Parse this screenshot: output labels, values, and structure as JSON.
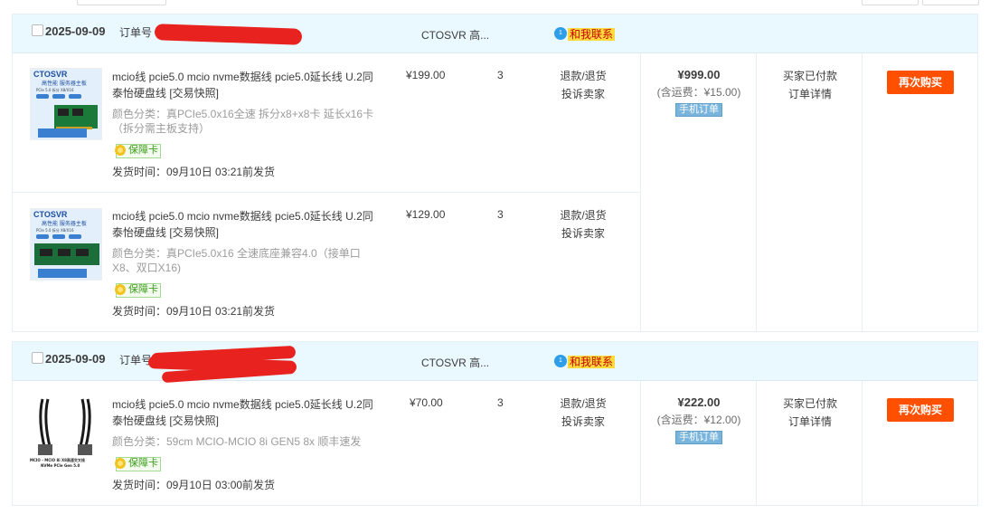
{
  "orders": [
    {
      "date": "2025-09-09",
      "order_no_label": "订单号",
      "shop": "CTOSVR 高...",
      "contact": "和我联系",
      "total": "¥999.00",
      "shipping_fee": "(含运费：¥15.00)",
      "mobile_tag": "手机订单",
      "status": "买家已付款",
      "detail_link": "订单详情",
      "rebuy": "再次购买",
      "items": [
        {
          "thumb_brand": "CTOSVR",
          "thumb_line1": "高性能 服务器主板",
          "thumb_line2": "PCIe 5.0 拆分 X8/X16",
          "title": "mcio线 pcie5.0 mcio nvme数据线 pcie5.0延长线 U.2同泰怡硬盘线 [交易快照]",
          "spec": "颜色分类：真PCIe5.0x16全速 拆分x8+x8卡 延长x16卡（拆分需主板支持）",
          "badge": "保障卡",
          "ship_time": "发货时间：09月10日 03:21前发货",
          "price": "¥199.00",
          "qty": "3",
          "refund": "退款/退货",
          "complain": "投诉卖家"
        },
        {
          "thumb_brand": "CTOSVR",
          "thumb_line1": "高性能 服务器主板",
          "thumb_line2": "PCIe 5.0 拆分 X8/X16",
          "title": "mcio线 pcie5.0 mcio nvme数据线 pcie5.0延长线 U.2同泰怡硬盘线 [交易快照]",
          "spec": "颜色分类：真PCIe5.0x16 全速底座兼容4.0（接单口X8、双口X16)",
          "badge": "保障卡",
          "ship_time": "发货时间：09月10日 03:21前发货",
          "price": "¥129.00",
          "qty": "3",
          "refund": "退款/退货",
          "complain": "投诉卖家"
        }
      ]
    },
    {
      "date": "2025-09-09",
      "order_no_label": "订单号",
      "shop": "CTOSVR 高...",
      "contact": "和我联系",
      "total": "¥222.00",
      "shipping_fee": "(含运费：¥12.00)",
      "mobile_tag": "手机订单",
      "status": "买家已付款",
      "detail_link": "订单详情",
      "rebuy": "再次购买",
      "items": [
        {
          "thumb_caption1": "MCIO - MCIO 8i X8高速交叉线",
          "thumb_caption2": "NVMe PCIe Gen 5.0",
          "title": "mcio线 pcie5.0 mcio nvme数据线 pcie5.0延长线 U.2同泰怡硬盘线 [交易快照]",
          "spec": "颜色分类：59cm MCIO-MCIO 8i GEN5 8x 顺丰速发",
          "badge": "保障卡",
          "ship_time": "发货时间：09月10日 03:00前发货",
          "price": "¥70.00",
          "qty": "3",
          "refund": "退款/退货",
          "complain": "投诉卖家"
        }
      ]
    }
  ],
  "colors": {
    "header_bg": "#eaf8ff",
    "rebuy_bg": "#ff4f00",
    "redaction": "#e8231f",
    "contact_bg": "#ffda3c"
  }
}
